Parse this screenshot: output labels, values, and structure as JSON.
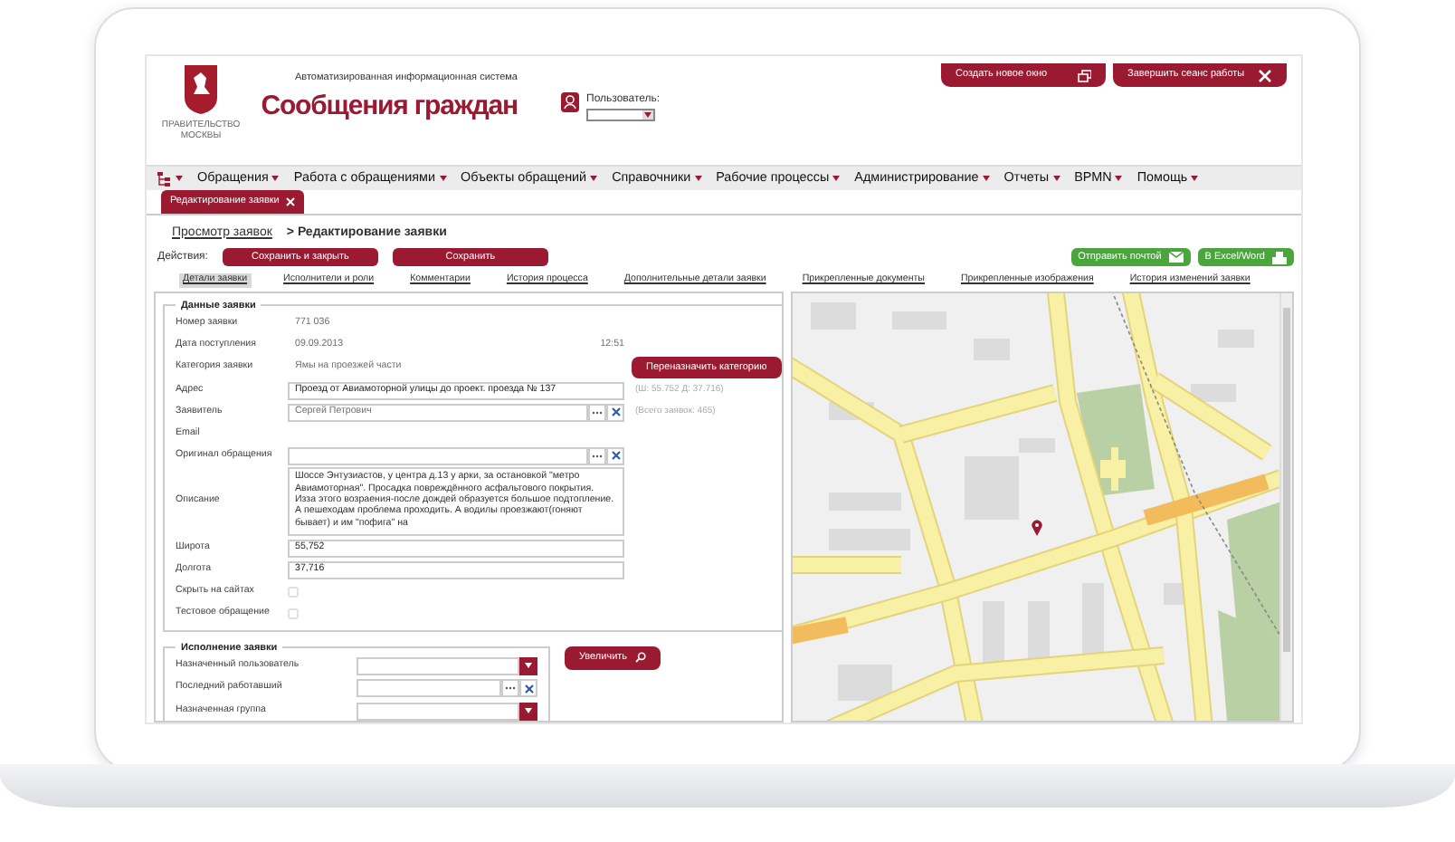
{
  "header": {
    "subtitle": "Автоматизированная информационная система",
    "title": "Сообщения граждан",
    "emblem_caption": [
      "ПРАВИТЕЛЬСТВО",
      "МОСКВЫ"
    ],
    "user_label": "Пользователь:",
    "buttons": [
      {
        "kind": "window",
        "label": "Создать новое окно"
      },
      {
        "kind": "close",
        "label": "Завершить сеанс работы"
      }
    ]
  },
  "menu": [
    "Обращения",
    "Работа с обращениями",
    "Объекты обращений",
    "Справочники",
    "Рабочие процессы",
    "Администрирование",
    "Отчеты",
    "BPMN",
    "Помощь"
  ],
  "open_tabs": [
    {
      "label": "Редактирование заявки",
      "selected": true
    }
  ],
  "breadcrumb": {
    "link": "Просмотр заявок",
    "current": "> Редактирование заявки"
  },
  "actions": {
    "label": "Действия:",
    "buttons": [
      "Сохранить и закрыть",
      "Сохранить"
    ],
    "right_buttons": [
      {
        "kind": "mail",
        "label": "Отправить почтой"
      },
      {
        "kind": "print",
        "label": "В Excel/Word"
      }
    ]
  },
  "detail_tabs": [
    {
      "label": "Детали заявки",
      "selected": true
    },
    {
      "label": "Исполнители и роли",
      "selected": false
    },
    {
      "label": "Комментарии",
      "selected": false
    },
    {
      "label": "История процесса",
      "selected": false
    },
    {
      "label": "Дополнительные детали заявки",
      "selected": false
    },
    {
      "label": "Прикрепленные документы",
      "selected": false
    },
    {
      "label": "Прикрепленные изображения",
      "selected": false
    },
    {
      "label": "История изменений заявки",
      "selected": false
    }
  ],
  "request_data": {
    "legend": "Данные заявки",
    "fields": [
      {
        "kind": "text",
        "label": "Номер заявки",
        "value": "771 036"
      },
      {
        "kind": "text",
        "label": "Дата поступления",
        "value": "09.09.2013",
        "time": "12:51"
      },
      {
        "kind": "text",
        "label": "Категория заявки",
        "value": "Ямы на проезжей части",
        "button": "Переназначить категорию"
      },
      {
        "kind": "input",
        "label": "Адрес",
        "value": "Проезд от Авиамоторной улицы до проект. проезда № 137",
        "note": "(Ш: 55.752 Д: 37.716)"
      },
      {
        "kind": "lookup",
        "label": "Заявитель",
        "value": "Сергей Петрович",
        "note": "(Всего заявок: 465)"
      },
      {
        "kind": "label",
        "label": "Email"
      },
      {
        "kind": "lookup",
        "label": "Оригинал обращения"
      },
      {
        "kind": "textarea",
        "label": "Описание",
        "value": "Шоссе Энтузиастов, у центра д.13 у арки, за остановкой \"метро Авиамоторная\". Просадка повреждённого асфальтового покрытия. Изза этого возраения-после дождей образуется большое подтопление. А пешеходам проблема проходить. А водилы проезжают(гоняют бывает) и им \"пофига\" на"
      },
      {
        "kind": "input",
        "label": "Широта",
        "value": "55,752"
      },
      {
        "kind": "input",
        "label": "Долгота",
        "value": "37,716"
      },
      {
        "kind": "checkbox",
        "label": "Скрыть на сайтах",
        "checked": false
      },
      {
        "kind": "checkbox",
        "label": "Тестовое обращение",
        "checked": false
      }
    ]
  },
  "execution": {
    "legend": "Исполнение заявки",
    "zoom_button": "Увеличить",
    "fields": [
      {
        "kind": "select",
        "label": "Назначенный пользователь"
      },
      {
        "kind": "lookup",
        "label": "Последний работавший"
      },
      {
        "kind": "select",
        "label": "Назначенная группа"
      }
    ]
  }
}
